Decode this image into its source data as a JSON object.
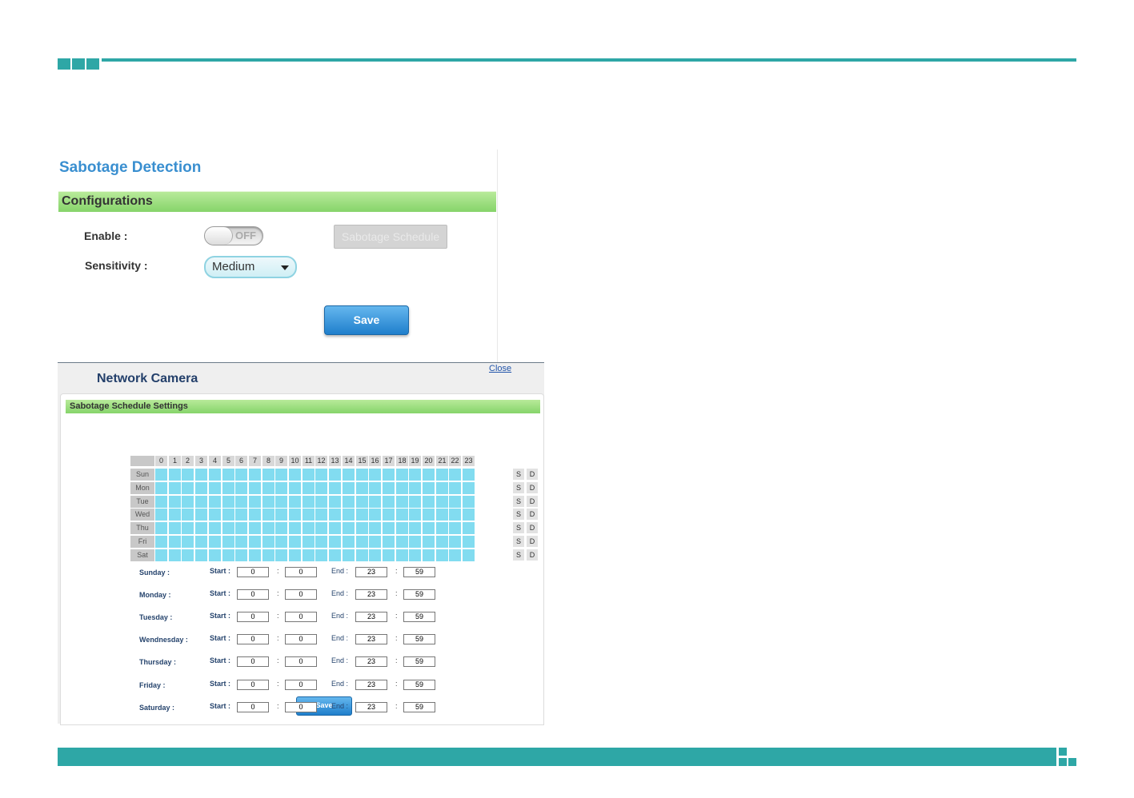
{
  "colors": {
    "accent": "#2ea7a6",
    "title_blue": "#3a8fd0",
    "green_bar": "#86d46a",
    "cell": "#82dcf0"
  },
  "sabotage": {
    "title": "Sabotage Detection",
    "section": "Configurations",
    "enable_label": "Enable :",
    "toggle_state": "OFF",
    "schedule_button": "Sabotage Schedule",
    "sensitivity_label": "Sensitivity :",
    "sensitivity_value": "Medium",
    "save_label": "Save"
  },
  "camera": {
    "title": "Network Camera",
    "close_label": "Close",
    "settings_title": "Sabotage Schedule Settings",
    "hours": [
      "0",
      "1",
      "2",
      "3",
      "4",
      "5",
      "6",
      "7",
      "8",
      "9",
      "10",
      "11",
      "12",
      "13",
      "14",
      "15",
      "16",
      "17",
      "18",
      "19",
      "20",
      "21",
      "22",
      "23"
    ],
    "days_short": [
      "Sun",
      "Mon",
      "Tue",
      "Wed",
      "Thu",
      "Fri",
      "Sat"
    ],
    "select_label": "S",
    "deselect_label": "D",
    "start_label": "Start :",
    "end_label": "End :",
    "colon": ":",
    "rows": [
      {
        "day": "Sunday :",
        "start_h": "0",
        "start_m": "0",
        "end_h": "23",
        "end_m": "59"
      },
      {
        "day": "Monday :",
        "start_h": "0",
        "start_m": "0",
        "end_h": "23",
        "end_m": "59"
      },
      {
        "day": "Tuesday :",
        "start_h": "0",
        "start_m": "0",
        "end_h": "23",
        "end_m": "59"
      },
      {
        "day": "Wendnesday :",
        "start_h": "0",
        "start_m": "0",
        "end_h": "23",
        "end_m": "59"
      },
      {
        "day": "Thursday :",
        "start_h": "0",
        "start_m": "0",
        "end_h": "23",
        "end_m": "59"
      },
      {
        "day": "Friday :",
        "start_h": "0",
        "start_m": "0",
        "end_h": "23",
        "end_m": "59"
      },
      {
        "day": "Saturday :",
        "start_h": "0",
        "start_m": "0",
        "end_h": "23",
        "end_m": "59"
      }
    ],
    "save_label": "Save"
  }
}
